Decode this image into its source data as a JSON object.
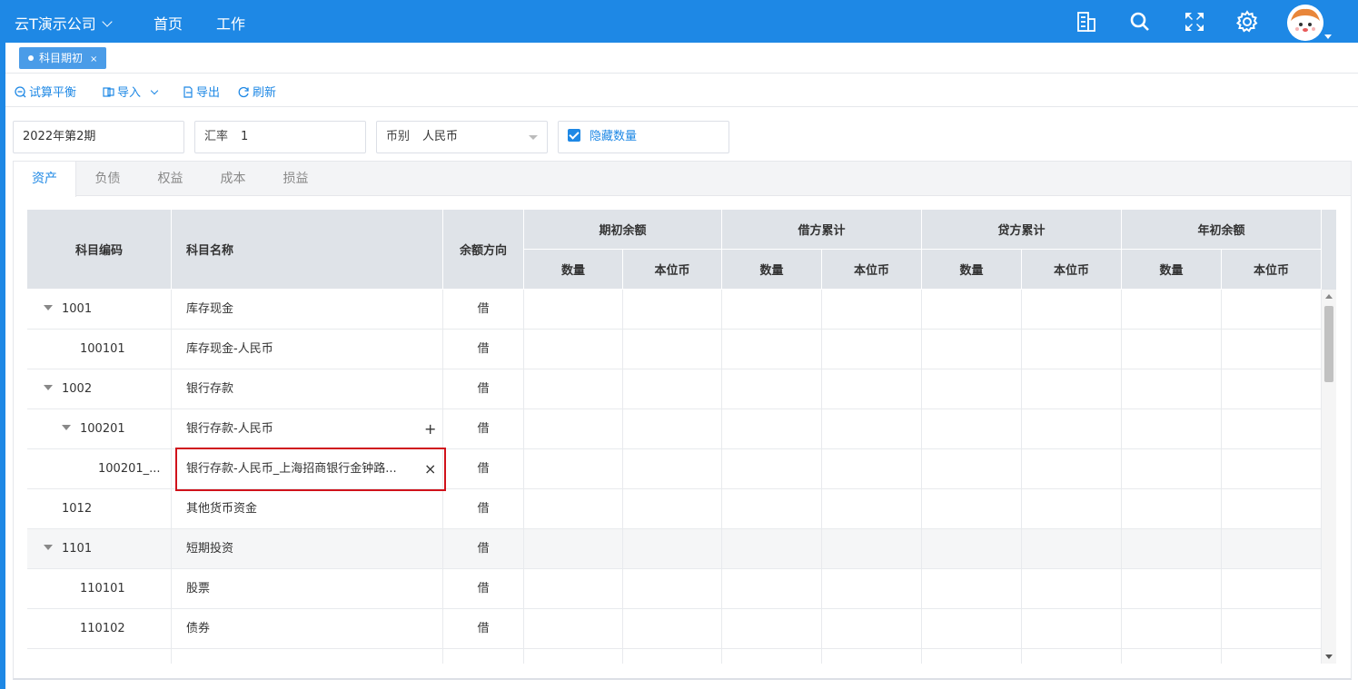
{
  "header": {
    "company": "云T演示公司",
    "nav": [
      "首页",
      "工作"
    ],
    "active_nav": "工作"
  },
  "tabs": [
    {
      "label": "科目期初",
      "close": "×"
    }
  ],
  "toolbar": {
    "trial_balance": "试算平衡",
    "import": "导入",
    "export": "导出",
    "refresh": "刷新"
  },
  "filters": {
    "period": "2022年第2期",
    "rate_label": "汇率",
    "rate_value": "1",
    "currency_label": "币别",
    "currency_value": "人民币",
    "hide_qty_label": "隐藏数量",
    "hide_qty_checked": true
  },
  "subtabs": [
    "资产",
    "负债",
    "权益",
    "成本",
    "损益"
  ],
  "active_subtab": "资产",
  "table": {
    "headers": {
      "code": "科目编码",
      "name": "科目名称",
      "direction": "余额方向",
      "groups": [
        "期初余额",
        "借方累计",
        "贷方累计",
        "年初余额"
      ],
      "sub": [
        "数量",
        "本位币"
      ]
    },
    "rows": [
      {
        "code": "1001",
        "name": "库存现金",
        "direction": "借"
      },
      {
        "code": "100101",
        "name": "库存现金-人民币",
        "direction": "借"
      },
      {
        "code": "1002",
        "name": "银行存款",
        "direction": "借"
      },
      {
        "code": "100201",
        "name": "银行存款-人民币",
        "direction": "借",
        "action": "+"
      },
      {
        "code": "100201_...",
        "name": "银行存款-人民币_上海招商银行金钟路...",
        "direction": "借",
        "action": "×"
      },
      {
        "code": "1012",
        "name": "其他货币资金",
        "direction": "借"
      },
      {
        "code": "1101",
        "name": "短期投资",
        "direction": "借"
      },
      {
        "code": "110101",
        "name": "股票",
        "direction": "借"
      },
      {
        "code": "110102",
        "name": "债券",
        "direction": "借"
      }
    ]
  },
  "colors": {
    "primary": "#1e88e5",
    "highlight": "#d0121b",
    "header_bg": "#dfe3e8"
  }
}
